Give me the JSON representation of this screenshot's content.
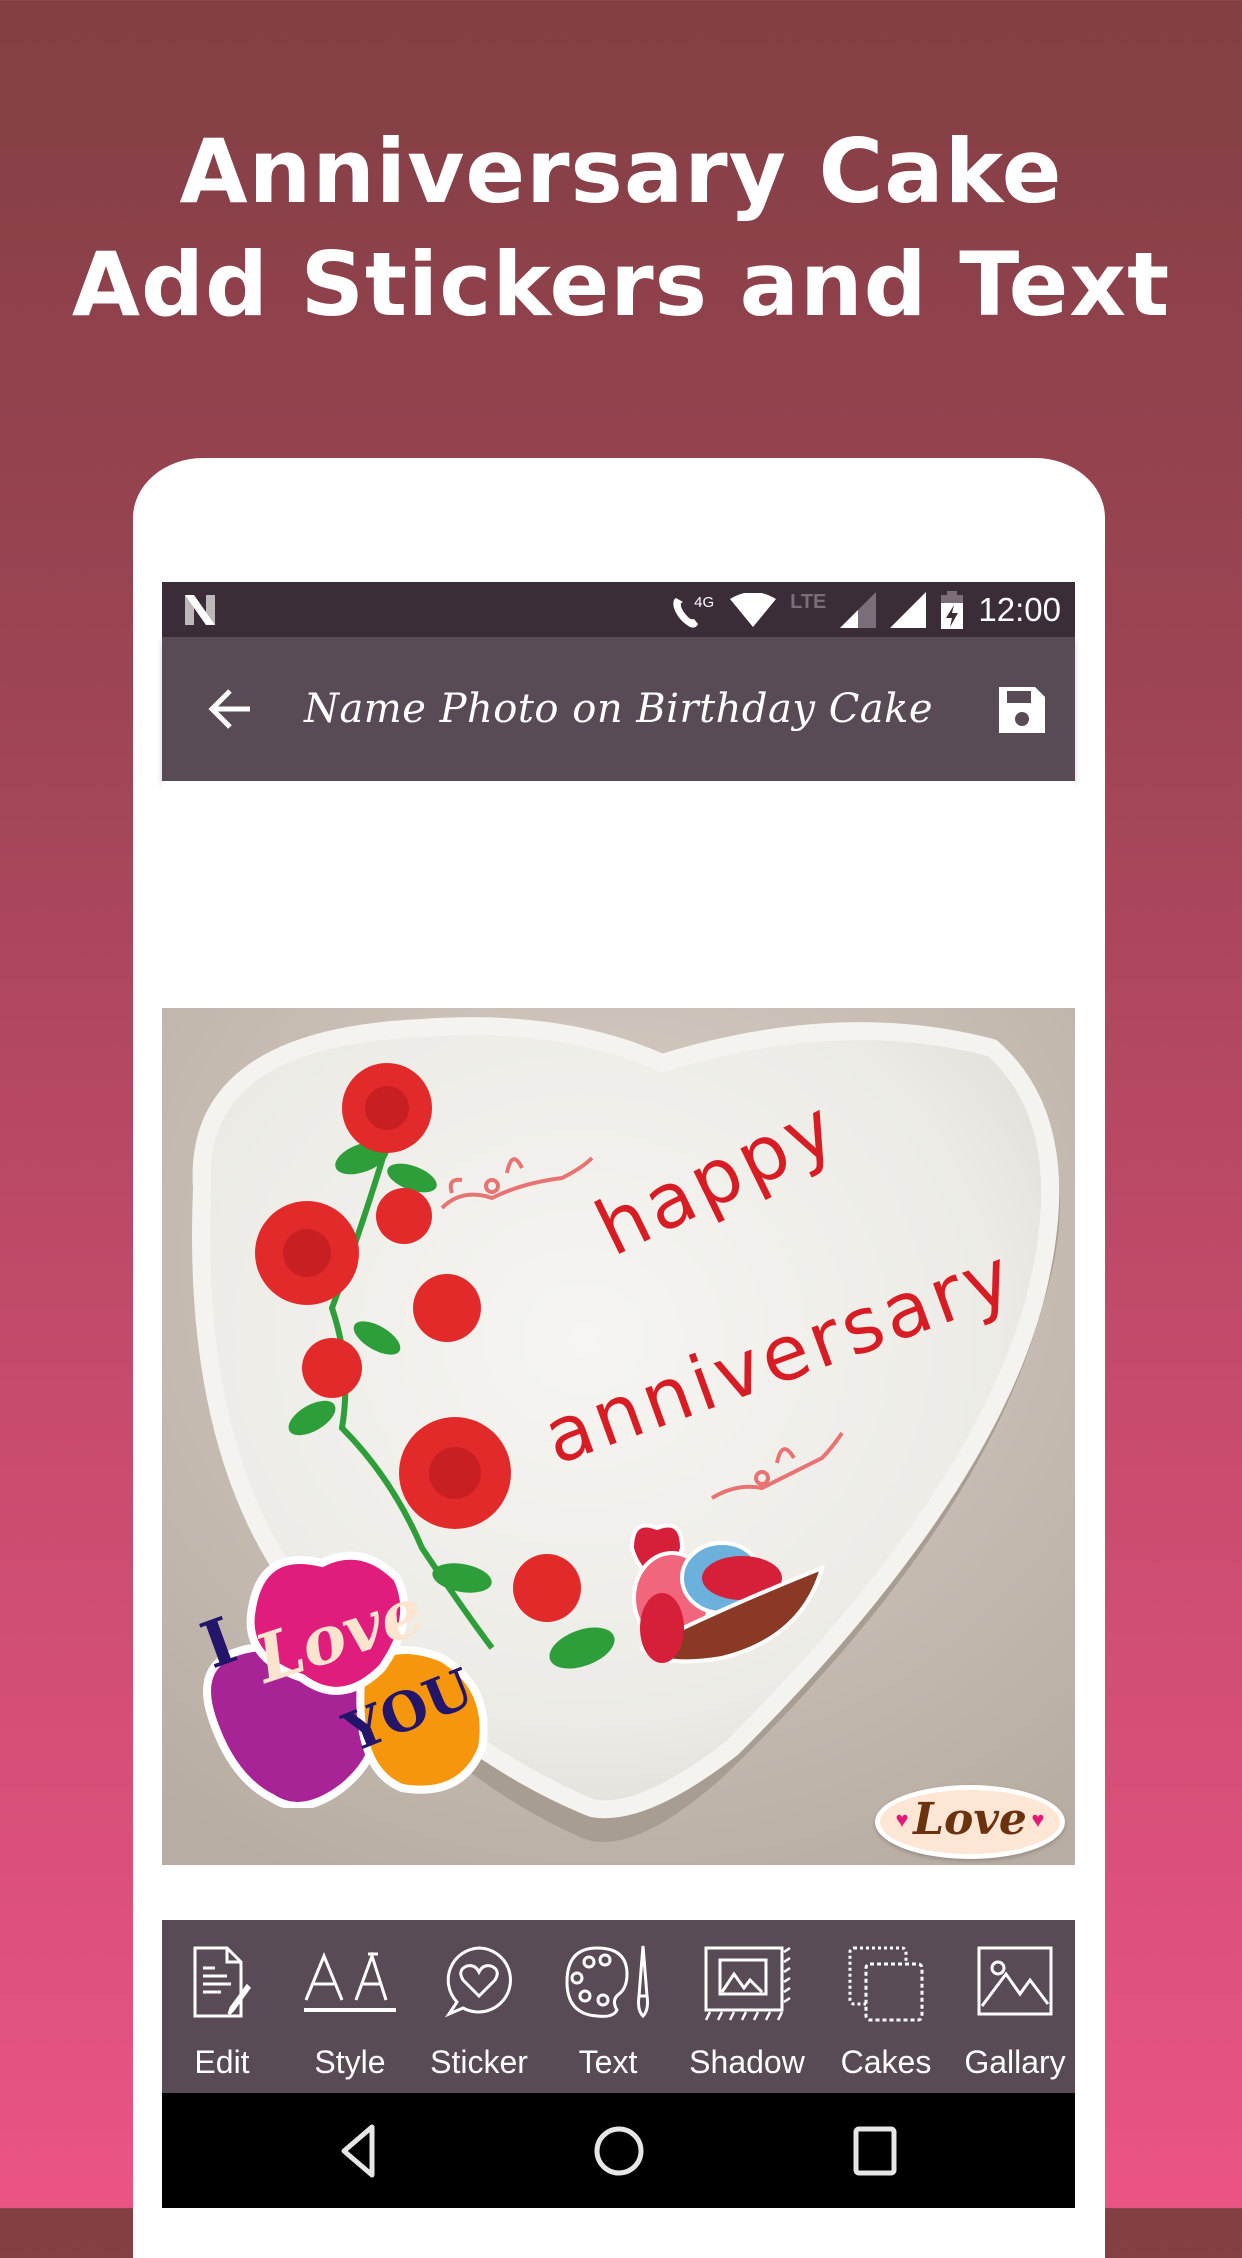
{
  "promo": {
    "line1": "Anniversary Cake",
    "line2": "Add Stickers and Text"
  },
  "status_bar": {
    "network_badge": "4G",
    "lte_label": "LTE",
    "time": "12:00",
    "icons": [
      "notification-n-icon",
      "call-4g-icon",
      "wifi-icon",
      "lte-signal-icon",
      "signal-icon",
      "battery-charging-icon"
    ]
  },
  "toolbar": {
    "title": "Name Photo on Birthday Cake",
    "back_icon": "arrow-left-icon",
    "save_icon": "floppy-disk-icon"
  },
  "canvas": {
    "cake_text_line1": "happy",
    "cake_text_line2": "anniversary",
    "stickers": {
      "i_love_you": {
        "i": "I",
        "love": "Love",
        "you": "YOU"
      },
      "love_badge": "Love",
      "birds_nest": "love-birds-in-nest"
    },
    "colors": {
      "cake_text": "#d81c24",
      "rose": "#e32a2a",
      "leaf": "#2e9e3a"
    }
  },
  "bottom_tools": [
    {
      "label": "Edit",
      "icon": "document-edit-icon"
    },
    {
      "label": "Style",
      "icon": "font-style-icon"
    },
    {
      "label": "Sticker",
      "icon": "heart-bubble-icon"
    },
    {
      "label": "Text",
      "icon": "palette-brush-icon"
    },
    {
      "label": "Shadow",
      "icon": "framed-picture-icon"
    },
    {
      "label": "Cakes",
      "icon": "layers-icon"
    },
    {
      "label": "Gallary",
      "icon": "image-icon"
    }
  ],
  "nav_bar": {
    "back": "nav-back-icon",
    "home": "nav-home-icon",
    "recents": "nav-recents-icon"
  },
  "theme": {
    "bar_color": "#594b56",
    "status_color": "#3a2d38",
    "bg_top": "#833f44",
    "bg_bottom": "#ea5485"
  }
}
